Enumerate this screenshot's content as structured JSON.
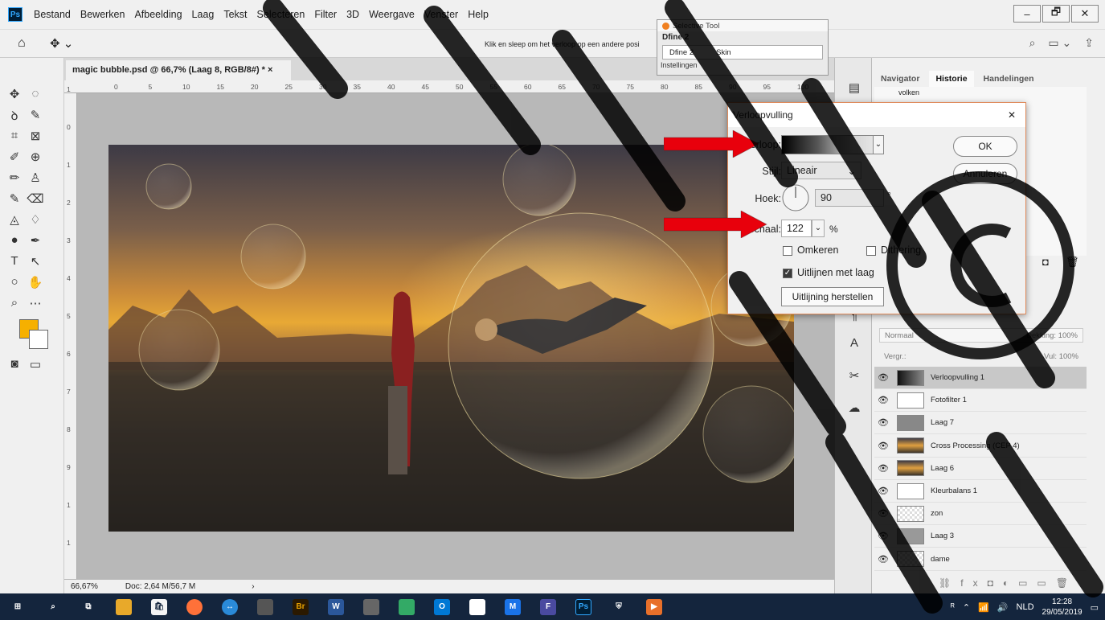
{
  "menubar": {
    "logo": "Ps",
    "items": [
      "Bestand",
      "Bewerken",
      "Afbeelding",
      "Laag",
      "Tekst",
      "Selecteren",
      "Filter",
      "3D",
      "Weergave",
      "Venster",
      "Help"
    ],
    "controls": [
      "–",
      "🗗",
      "✕"
    ]
  },
  "options": {
    "hint": "Klik en sleep om het verloop op een andere posi"
  },
  "selective": {
    "title": "Selective Tool",
    "preset": "Dfine 2",
    "col1": "Dfine 2",
    "col2": "Skin",
    "footer": "Instellingen"
  },
  "document": {
    "tab": "magic bubble.psd @ 66,7% (Laag 8, RGB/8#) *",
    "close": "×",
    "zoom": "66,67%",
    "doc_size": "Doc: 2,64 M/56,7 M"
  },
  "ruler": {
    "h": [
      "0",
      "5",
      "10",
      "15",
      "20",
      "25",
      "30",
      "35",
      "40",
      "45",
      "50",
      "55",
      "60",
      "65",
      "70",
      "75",
      "80",
      "85",
      "90",
      "95",
      "100"
    ],
    "v": [
      "1",
      "0",
      "1",
      "2",
      "3",
      "4",
      "5",
      "6",
      "7",
      "8",
      "9",
      "1",
      "1"
    ]
  },
  "panels": {
    "tabs": [
      "Navigator",
      "Historie",
      "Handelingen"
    ],
    "history_partial": "volken"
  },
  "layers": {
    "blend": "Normaal",
    "opacity_label": "Dekking:",
    "opacity": "100%",
    "lock_label": "Vergr.:",
    "fill_label": "Vul:",
    "fill": "100%",
    "items": [
      {
        "name": "Verloopvulling 1",
        "selected": true
      },
      {
        "name": "Fotofilter 1"
      },
      {
        "name": "Laag 7"
      },
      {
        "name": "Cross Processing (CEP 4)"
      },
      {
        "name": "Laag 6"
      },
      {
        "name": "Kleurbalans 1"
      },
      {
        "name": "zon"
      },
      {
        "name": "Laag 3"
      },
      {
        "name": "dame"
      }
    ]
  },
  "dialog": {
    "title": "Verloopvulling",
    "close": "✕",
    "verloop_label": "Verloop:",
    "stijl_label": "Stijl:",
    "stijl_value": "Lineair",
    "hoek_label": "Hoek:",
    "hoek_value": "90",
    "hoek_unit": "°",
    "schaal_label": "Schaal:",
    "schaal_value": "122",
    "schaal_unit": "%",
    "omkeren": "Omkeren",
    "dithering": "Dithering",
    "uitlijnen": "Uitlijnen met laag",
    "herstellen": "Uitlijning herstellen",
    "ok": "OK",
    "annuleren": "Annuleren"
  },
  "taskbar": {
    "lang": "NLD",
    "time": "12:28",
    "date": "29/05/2019"
  },
  "colors": {
    "foreground": "#f6b000",
    "background": "#ffffff",
    "accent": "#e08a5a",
    "arrow": "#e8000c"
  }
}
